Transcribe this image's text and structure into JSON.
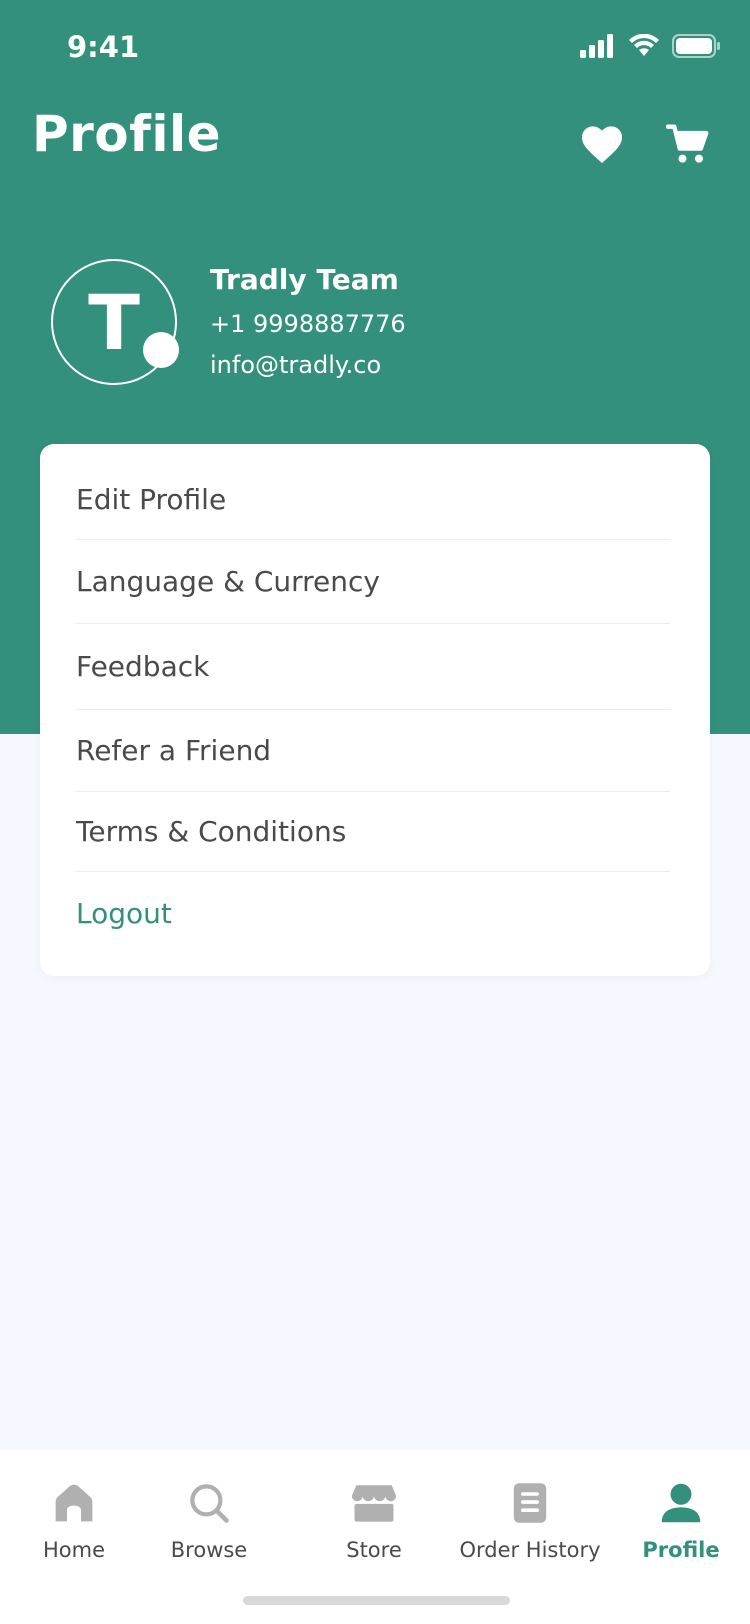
{
  "status_bar": {
    "time": "9:41"
  },
  "header": {
    "title": "Profile"
  },
  "user": {
    "initial": "T",
    "name": "Tradly Team",
    "phone": "+1 9998887776",
    "email": "info@tradly.co"
  },
  "menu": {
    "items": [
      {
        "label": "Edit Profile"
      },
      {
        "label": "Language & Currency"
      },
      {
        "label": "Feedback"
      },
      {
        "label": "Refer a Friend"
      },
      {
        "label": "Terms & Conditions"
      },
      {
        "label": "Logout"
      }
    ]
  },
  "tab_bar": {
    "items": [
      {
        "label": "Home",
        "icon": "home-icon"
      },
      {
        "label": "Browse",
        "icon": "search-icon"
      },
      {
        "label": "Store",
        "icon": "store-icon"
      },
      {
        "label": "Order History",
        "icon": "order-history-icon"
      },
      {
        "label": "Profile",
        "icon": "profile-icon"
      }
    ],
    "active": "Profile"
  },
  "colors": {
    "primary": "#33907c",
    "background": "#f5f8fe",
    "text": "#4a4a4a",
    "inactive_icon": "#b0b0b0"
  }
}
